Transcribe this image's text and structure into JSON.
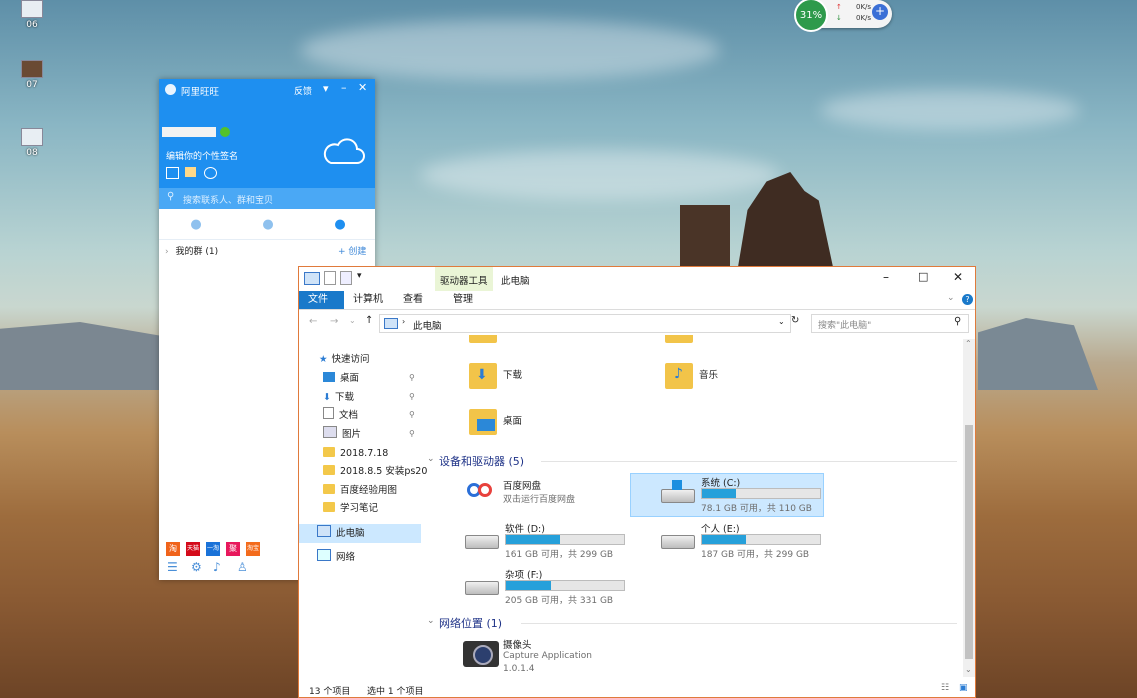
{
  "desktop": {
    "icons": [
      {
        "label": "06"
      },
      {
        "label": "07"
      },
      {
        "label": "08"
      }
    ]
  },
  "speed_widget": {
    "percent": "31%",
    "up": "0K/s",
    "down": "0K/s",
    "up_arrow": "↑",
    "down_arrow": "↓"
  },
  "aliwangwang": {
    "title": "阿里旺旺",
    "feedback": "反馈",
    "signature": "编辑你的个性签名",
    "search_placeholder": "搜索联系人、群和宝贝",
    "group_label": "我的群 (1)",
    "create_label": "+ 创建",
    "bottom_apps": [
      "淘",
      "天猫",
      "一淘",
      "聚",
      "淘宝"
    ]
  },
  "explorer": {
    "title": "此电脑",
    "drive_tools_tab": "驱动器工具",
    "ribbon_tabs": [
      "文件",
      "计算机",
      "查看",
      "管理"
    ],
    "address": "此电脑",
    "search_placeholder": "搜索\"此电脑\"",
    "nav": {
      "quick_access": "快速访问",
      "items": [
        {
          "label": "桌面"
        },
        {
          "label": "下载"
        },
        {
          "label": "文档"
        },
        {
          "label": "图片"
        },
        {
          "label": "2018.7.18"
        },
        {
          "label": "2018.8.5 安装ps20"
        },
        {
          "label": "百度经验用图"
        },
        {
          "label": "学习笔记"
        }
      ],
      "this_pc": "此电脑",
      "network": "网络"
    },
    "folders": [
      {
        "label": "下载"
      },
      {
        "label": "音乐"
      },
      {
        "label": "桌面"
      }
    ],
    "devices_header": "设备和驱动器 (5)",
    "baidu": {
      "name": "百度网盘",
      "desc": "双击运行百度网盘"
    },
    "drives": [
      {
        "name": "系统 (C:)",
        "size": "78.1 GB 可用，共 110 GB",
        "used_fraction": 0.29
      },
      {
        "name": "软件 (D:)",
        "size": "161 GB 可用，共 299 GB",
        "used_fraction": 0.46
      },
      {
        "name": "个人 (E:)",
        "size": "187 GB 可用，共 299 GB",
        "used_fraction": 0.37
      },
      {
        "name": "杂项 (F:)",
        "size": "205 GB 可用，共 331 GB",
        "used_fraction": 0.38
      }
    ],
    "network_header": "网络位置 (1)",
    "camera": {
      "name": "摄像头",
      "desc": "Capture Application",
      "version": "1.0.1.4"
    },
    "status_items": "13 个项目",
    "status_selected": "选中 1 个项目"
  }
}
